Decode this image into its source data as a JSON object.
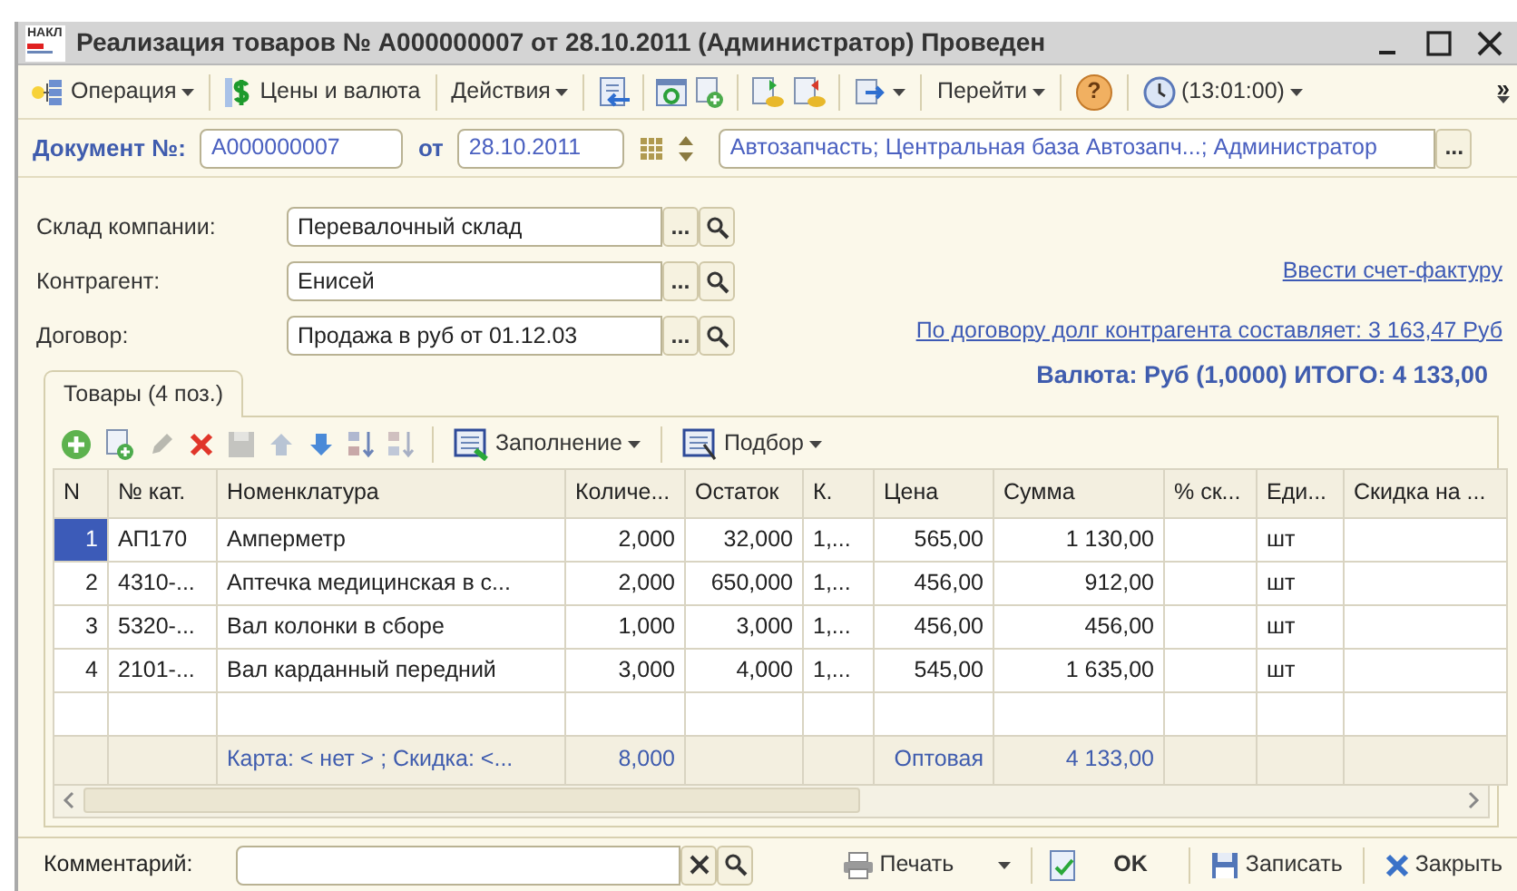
{
  "window": {
    "title": "Реализация товаров № А000000007 от 28.10.2011 (Администратор) Проведен",
    "badge": "НАКЛ"
  },
  "toolbar": [
    {
      "label": "Операция",
      "dropdown": true
    },
    {
      "label": "Цены и валюта",
      "dropdown": false
    },
    {
      "label": "Действия",
      "dropdown": true
    },
    {
      "label": "Перейти",
      "dropdown": true
    },
    {
      "label": "?",
      "dropdown": false
    },
    {
      "label": "(13:01:00)",
      "dropdown": true
    }
  ],
  "toolbar_overflow": "»",
  "document": {
    "number_label": "Документ №:",
    "number": "А000000007",
    "date_label": "от",
    "date": "28.10.2011",
    "organization": "Автозапчасть; Центральная база Автозапч...; Администратор",
    "select_label": "..."
  },
  "fields": [
    {
      "label": "Склад компании:",
      "value": "Перевалочный склад",
      "select_label": "..."
    },
    {
      "label": "Контрагент:",
      "value": "Енисей",
      "select_label": "..."
    },
    {
      "label": "Договор:",
      "value": "Продажа в руб от 01.12.03",
      "select_label": "..."
    }
  ],
  "links": [
    "Ввести счет-фактуру",
    "По договору долг контрагента составляет: 3 163,47 Руб"
  ],
  "total": "Валюта: Руб (1,0000) ИТОГО: 4 133,00",
  "tabs": [
    {
      "label": "Товары (4 поз.)",
      "selected": true
    }
  ],
  "table_toolbar": [
    {
      "label": "Заполнение",
      "dropdown": true
    },
    {
      "label": "Подбор",
      "dropdown": true
    }
  ],
  "table": {
    "columns": [
      {
        "label": "N"
      },
      {
        "label": "№ кат."
      },
      {
        "label": "Номенклатура",
        "footer": "Карта: < нет > ; Скидка: <..."
      },
      {
        "label": "Количе...",
        "footer": "8,000"
      },
      {
        "label": "Остаток"
      },
      {
        "label": "К."
      },
      {
        "label": "Цена",
        "footer": "Оптовая"
      },
      {
        "label": "Сумма",
        "footer": "4 133,00"
      },
      {
        "label": "% ск..."
      },
      {
        "label": "Еди..."
      },
      {
        "label": "Скидка на ..."
      }
    ],
    "rows": [
      {
        "selected": true,
        "cells": [
          "1",
          "АП170",
          "Амперметр",
          "2,000",
          "32,000",
          "1,...",
          "565,00",
          "1 130,00",
          null,
          "шт",
          null
        ]
      },
      {
        "selected": false,
        "cells": [
          "2",
          "4310-...",
          "Аптечка медицинская в с...",
          "2,000",
          "650,000",
          "1,...",
          "456,00",
          "912,00",
          null,
          "шт",
          null
        ]
      },
      {
        "selected": false,
        "cells": [
          "3",
          "5320-...",
          "Вал колонки в сборе",
          "1,000",
          "3,000",
          "1,...",
          "456,00",
          "456,00",
          null,
          "шт",
          null
        ]
      },
      {
        "selected": false,
        "cells": [
          "4",
          "2101-...",
          "Вал карданный передний",
          "3,000",
          "4,000",
          "1,...",
          "545,00",
          "1 635,00",
          null,
          "шт",
          null
        ]
      }
    ]
  },
  "comment": {
    "label": "Комментарий:"
  },
  "bottom_buttons": [
    {
      "label": "Печать",
      "kind": "print"
    },
    {
      "label": "OK",
      "kind": "ok"
    },
    {
      "label": "Записать",
      "kind": "save"
    },
    {
      "label": "Закрыть",
      "kind": "close"
    }
  ]
}
